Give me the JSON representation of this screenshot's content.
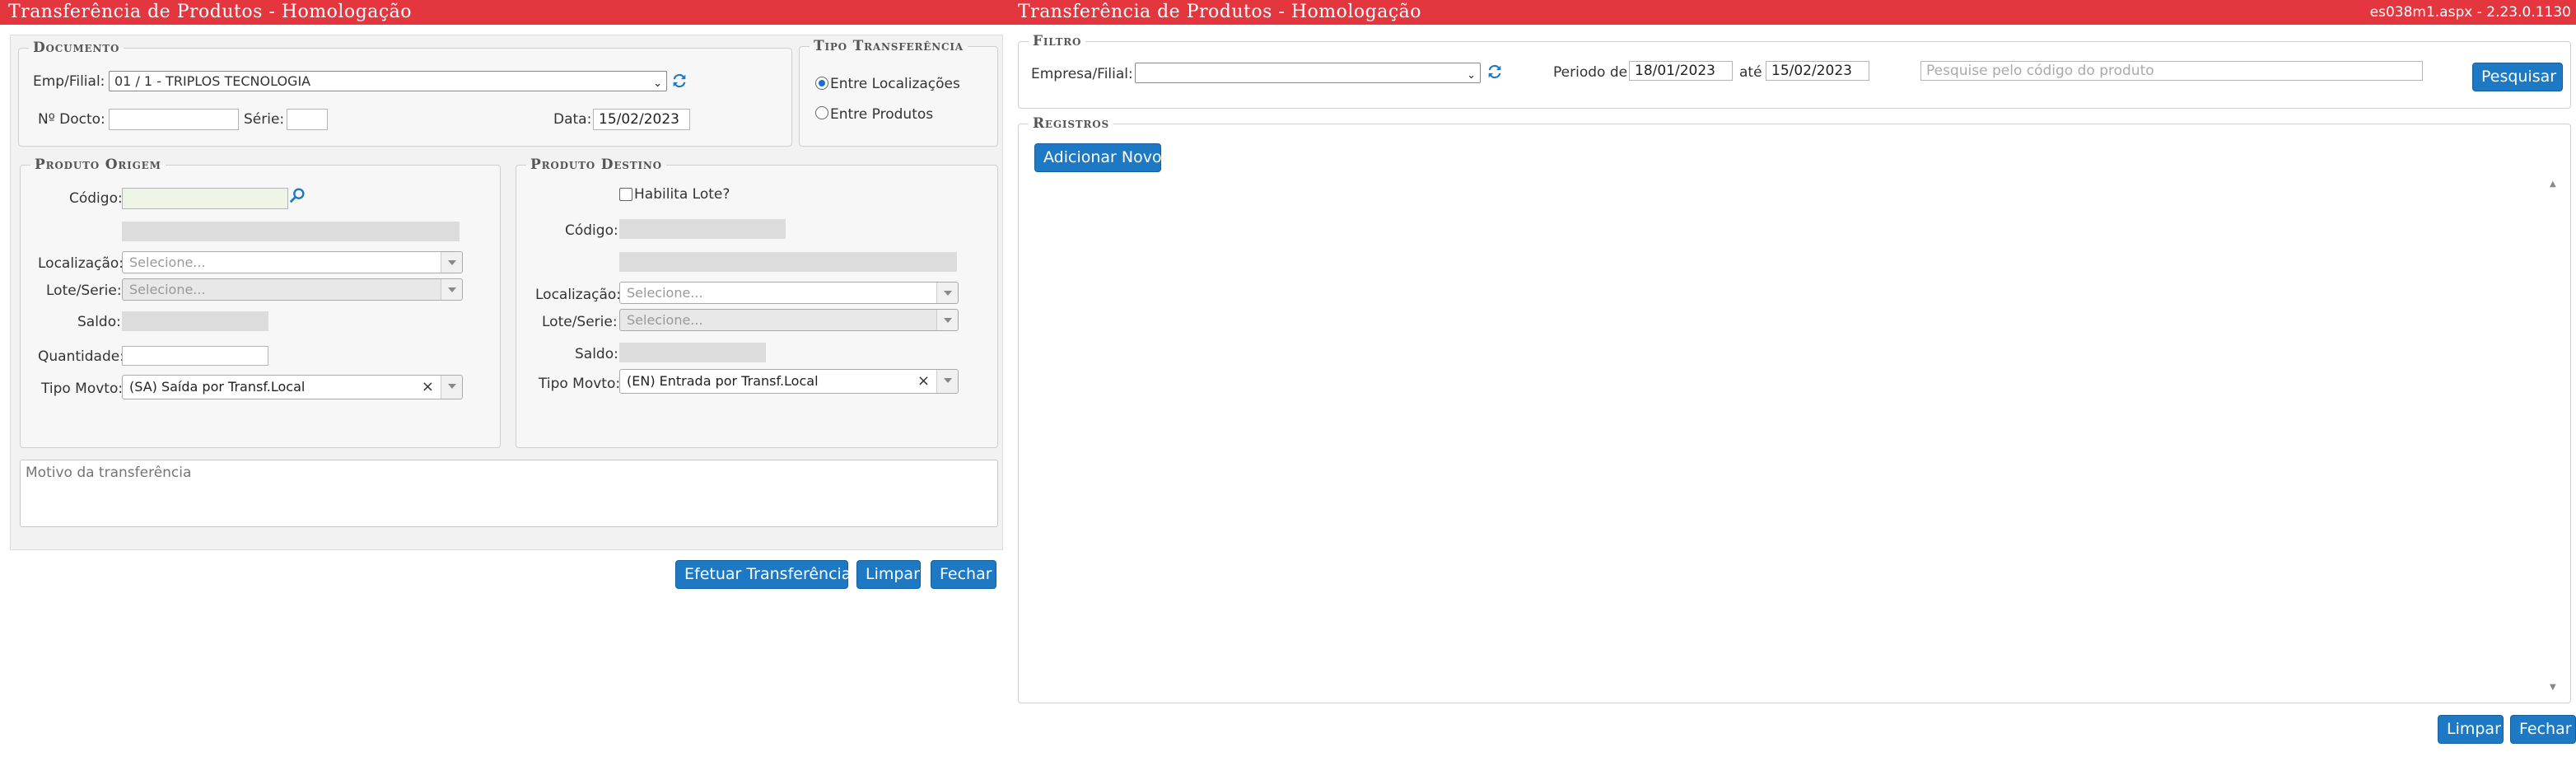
{
  "left": {
    "title": "Transferência de Produtos  - Homologação",
    "documento": {
      "legend": "Documento",
      "emp_label": "Emp/Filial:",
      "emp_value": "01 / 1 - TRIPLOS TECNOLOGIA",
      "ndocto_label": "Nº Docto:",
      "serie_label": "Série:",
      "data_label": "Data:",
      "data_value": "15/02/2023"
    },
    "tipo": {
      "legend": "Tipo Transferência",
      "opt1": "Entre Localizações",
      "opt2": "Entre Produtos",
      "selected": "Entre Localizações"
    },
    "origem": {
      "legend": "Produto Origem",
      "codigo_label": "Código:",
      "localizacao_label": "Localização:",
      "localizacao_placeholder": "Selecione...",
      "lote_label": "Lote/Serie:",
      "lote_placeholder": "Selecione...",
      "saldo_label": "Saldo:",
      "quantidade_label": "Quantidade:",
      "tipomovto_label": "Tipo Movto:",
      "tipomovto_value": "(SA) Saída por Transf.Local"
    },
    "destino": {
      "legend": "Produto Destino",
      "habilita_label": "Habilita Lote?",
      "codigo_label": "Código:",
      "localizacao_label": "Localização:",
      "localizacao_placeholder": "Selecione...",
      "lote_label": "Lote/Serie:",
      "lote_placeholder": "Selecione...",
      "saldo_label": "Saldo:",
      "tipomovto_label": "Tipo Movto:",
      "tipomovto_value": "(EN) Entrada por Transf.Local"
    },
    "motivo_placeholder": "Motivo da transferência",
    "buttons": {
      "efetuar": "Efetuar Transferência",
      "limpar": "Limpar",
      "fechar": "Fechar"
    }
  },
  "right": {
    "title": "Transferência de Produtos  - Homologação",
    "version": "es038m1.aspx - 2.23.0.1130",
    "filtro": {
      "legend": "Filtro",
      "empresa_label": "Empresa/Filial:",
      "periodo_label": "Periodo de",
      "periodo_de": "18/01/2023",
      "ate_label": "até",
      "periodo_ate": "15/02/2023",
      "search_placeholder": "Pesquise pelo código do produto",
      "pesquisar": "Pesquisar"
    },
    "registros": {
      "legend": "Registros",
      "adicionar": "Adicionar Novo"
    },
    "buttons": {
      "limpar": "Limpar",
      "fechar": "Fechar"
    }
  },
  "colors": {
    "titlebar": "#e4363f",
    "button": "#1d79c4"
  }
}
